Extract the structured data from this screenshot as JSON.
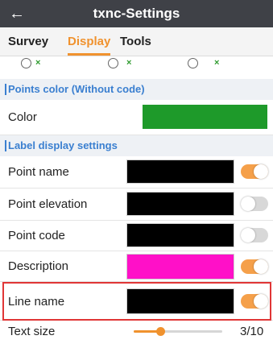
{
  "header": {
    "title": "txnc-Settings",
    "back_icon": "arrow-left-icon"
  },
  "tabs": [
    {
      "label": "Survey",
      "active": false
    },
    {
      "label": "Display",
      "active": true
    },
    {
      "label": "Tools",
      "active": false
    }
  ],
  "radio_row": {
    "mark": "×"
  },
  "points_color_section": {
    "title": "Points color (Without code)",
    "color_row": {
      "label": "Color",
      "color": "#1e9a2a"
    }
  },
  "label_section": {
    "title": "Label display settings"
  },
  "label_rows": [
    {
      "label": "Point name",
      "color": "#000000",
      "enabled": true
    },
    {
      "label": "Point elevation",
      "color": "#000000",
      "enabled": false
    },
    {
      "label": "Point code",
      "color": "#000000",
      "enabled": false
    },
    {
      "label": "Description",
      "color": "#ff10c8",
      "enabled": true
    },
    {
      "label": "Line name",
      "color": "#000000",
      "enabled": true
    }
  ],
  "text_size": {
    "label": "Text size",
    "value_text": "3/10",
    "value": 3,
    "max": 10
  },
  "colors": {
    "accent": "#f0922e",
    "header_bg": "#3f4147",
    "section_text": "#3a7fd0",
    "highlight_border": "#e03636"
  }
}
